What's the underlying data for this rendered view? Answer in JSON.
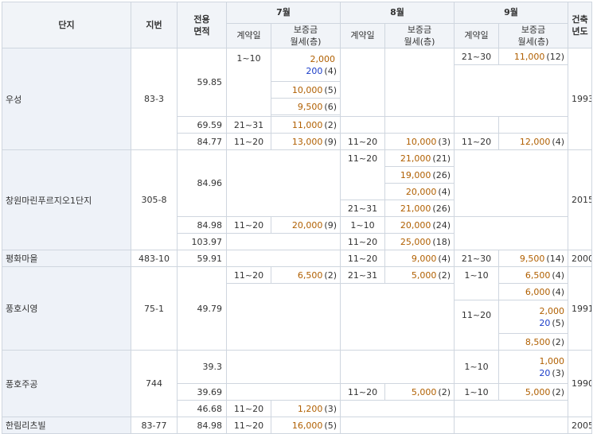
{
  "header": {
    "complex": "단지",
    "lot": "지번",
    "area_line1": "전용",
    "area_line2": "면적",
    "months": [
      "7월",
      "8월",
      "9월"
    ],
    "contract_day": "계약일",
    "deposit_line1": "보증금",
    "deposit_line2": "월세(층)",
    "built_line1": "건축",
    "built_line2": "년도"
  },
  "complexes": [
    {
      "name": "우성",
      "lot": "83-3",
      "year": "1993",
      "rows": [
        {
          "area": "59.85",
          "m7": [
            {
              "day": "1~10",
              "deposit": "2,000",
              "count": "",
              "rent": "200",
              "floor": "(4)"
            },
            {
              "deposit": "10,000",
              "floor": "(5)"
            },
            {
              "deposit": "9,500",
              "floor": "(6)"
            }
          ],
          "m8": [],
          "m9": [
            {
              "day": "21~30",
              "deposit": "11,000",
              "floor": "(12)"
            }
          ]
        },
        {
          "area": "69.59",
          "m7": [
            {
              "day": "21~31",
              "deposit": "11,000",
              "floor": "(2)"
            }
          ],
          "m8": [],
          "m9": []
        },
        {
          "area": "84.77",
          "m7": [
            {
              "day": "11~20",
              "deposit": "13,000",
              "floor": "(9)"
            }
          ],
          "m8": [
            {
              "day": "11~20",
              "deposit": "10,000",
              "floor": "(3)"
            }
          ],
          "m9": [
            {
              "day": "11~20",
              "deposit": "12,000",
              "floor": "(4)"
            }
          ]
        }
      ]
    },
    {
      "name": "창원마린푸르지오1단지",
      "lot": "305-8",
      "year": "2015",
      "rows": [
        {
          "area": "84.96",
          "m7": [],
          "m8": [
            {
              "day": "11~20",
              "deposit": "21,000",
              "floor": "(21)"
            },
            {
              "deposit": "19,000",
              "floor": "(26)"
            },
            {
              "deposit": "20,000",
              "floor": "(4)"
            },
            {
              "day": "21~31",
              "deposit": "21,000",
              "floor": "(26)"
            }
          ],
          "m9": []
        },
        {
          "area": "84.98",
          "m7": [
            {
              "day": "11~20",
              "deposit": "20,000",
              "floor": "(9)"
            }
          ],
          "m8": [
            {
              "day": "1~10",
              "deposit": "20,000",
              "floor": "(24)"
            }
          ],
          "m9": []
        },
        {
          "area": "103.97",
          "m7": [],
          "m8": [
            {
              "day": "11~20",
              "deposit": "25,000",
              "floor": "(18)"
            }
          ],
          "m9": []
        }
      ]
    },
    {
      "name": "평화마을",
      "lot": "483-10",
      "year": "2000",
      "rows": [
        {
          "area": "59.91",
          "m7": [],
          "m8": [
            {
              "day": "11~20",
              "deposit": "9,000",
              "floor": "(4)"
            }
          ],
          "m9": [
            {
              "day": "21~30",
              "deposit": "9,500",
              "floor": "(14)"
            }
          ]
        }
      ]
    },
    {
      "name": "풍호시영",
      "lot": "75-1",
      "year": "1991",
      "rows": [
        {
          "area": "49.79",
          "m7": [
            {
              "day": "11~20",
              "deposit": "6,500",
              "floor": "(2)"
            }
          ],
          "m8": [
            {
              "day": "21~31",
              "deposit": "5,000",
              "floor": "(2)"
            }
          ],
          "m9": [
            {
              "day": "1~10",
              "deposit": "6,500",
              "floor": "(4)"
            },
            {
              "deposit": "6,000",
              "floor": "(4)"
            },
            {
              "day": "11~20",
              "deposit": "2,000",
              "rent": "20",
              "floor": "(5)"
            },
            {
              "deposit": "8,500",
              "floor": "(2)"
            }
          ]
        }
      ]
    },
    {
      "name": "풍호주공",
      "lot": "744",
      "year": "1990",
      "rows": [
        {
          "area": "39.3",
          "m7": [],
          "m8": [],
          "m9": [
            {
              "day": "1~10",
              "deposit": "1,000",
              "rent": "20",
              "floor": "(3)"
            }
          ]
        },
        {
          "area": "39.69",
          "m7": [],
          "m8": [
            {
              "day": "11~20",
              "deposit": "5,000",
              "floor": "(2)"
            }
          ],
          "m9": [
            {
              "day": "1~10",
              "deposit": "5,000",
              "floor": "(2)"
            }
          ]
        },
        {
          "area": "46.68",
          "m7": [
            {
              "day": "11~20",
              "deposit": "1,200",
              "floor": "(3)"
            }
          ],
          "m8": [],
          "m9": []
        }
      ]
    },
    {
      "name": "한림리츠빌",
      "lot": "83-77",
      "year": "2005",
      "rows": [
        {
          "area": "84.98",
          "m7": [
            {
              "day": "11~20",
              "deposit": "16,000",
              "floor": "(5)"
            }
          ],
          "m8": [],
          "m9": []
        }
      ]
    }
  ],
  "colors": {
    "deposit": "#b05f00",
    "rent": "#1a3cc8",
    "header_bg": "#f1f4f8",
    "complex_bg": "#eef2f8",
    "border": "#cfd6df"
  }
}
